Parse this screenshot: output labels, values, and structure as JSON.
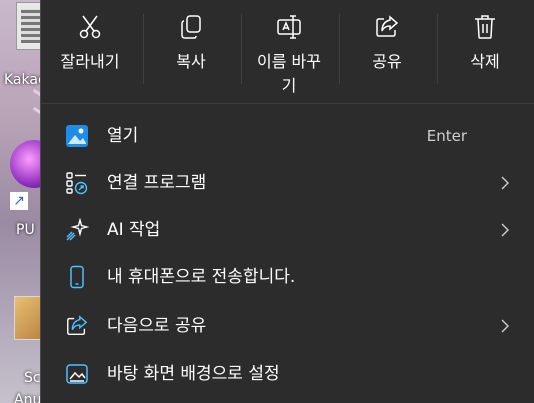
{
  "desktop": {
    "label1": "Kakac",
    "label2": "PU",
    "label3": "Sc",
    "label4": "Anu"
  },
  "toolbar": {
    "cut_label": "잘라내기",
    "copy_label": "복사",
    "rename_label_line1": "이름 바꾸",
    "rename_label_line2": "기",
    "share_label": "공유",
    "delete_label": "삭제"
  },
  "menu": {
    "items": [
      {
        "label": "열기",
        "accelerator": "Enter",
        "icon": "photos-app-icon"
      },
      {
        "label": "연결 프로그램",
        "icon": "open-with-icon",
        "submenu": true
      },
      {
        "label": "AI 작업",
        "icon": "ai-sparkle-icon",
        "submenu": true
      },
      {
        "label": "내 휴대폰으로 전송합니다.",
        "icon": "phone-icon"
      },
      {
        "label": "다음으로 공유",
        "icon": "share-icon",
        "submenu": true
      },
      {
        "label": "바탕 화면 배경으로 설정",
        "icon": "wallpaper-icon"
      }
    ]
  },
  "colors": {
    "menu_bg": "#2c2c2c",
    "accent": "#4cc2ff",
    "text": "#ffffff"
  }
}
